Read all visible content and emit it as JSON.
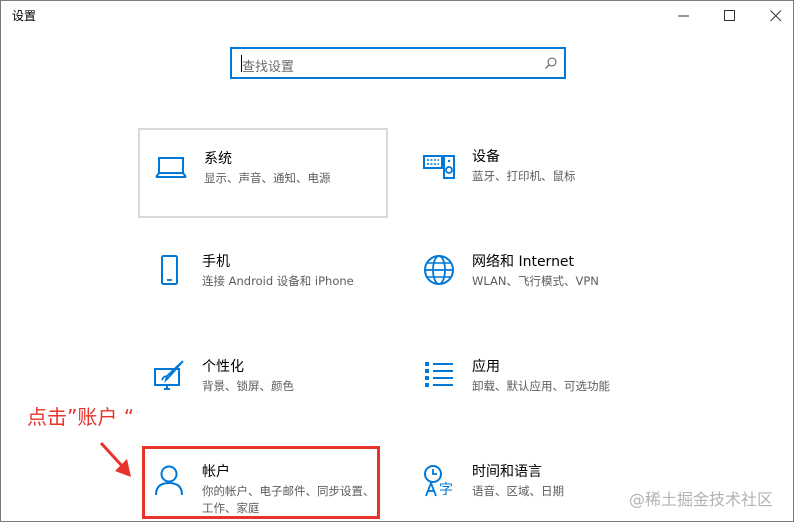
{
  "window": {
    "title": "设置"
  },
  "search": {
    "placeholder": "查找设置"
  },
  "tiles": [
    {
      "title": "系统",
      "desc": "显示、声音、通知、电源",
      "icon": "laptop-icon"
    },
    {
      "title": "设备",
      "desc": "蓝牙、打印机、鼠标",
      "icon": "keyboard-speaker-icon"
    },
    {
      "title": "手机",
      "desc": "连接 Android 设备和 iPhone",
      "icon": "phone-icon"
    },
    {
      "title": "网络和 Internet",
      "desc": "WLAN、飞行模式、VPN",
      "icon": "globe-icon"
    },
    {
      "title": "个性化",
      "desc": "背景、锁屏、颜色",
      "icon": "paint-monitor-icon"
    },
    {
      "title": "应用",
      "desc": "卸载、默认应用、可选功能",
      "icon": "apps-list-icon"
    },
    {
      "title": "帐户",
      "desc": "你的帐户、电子邮件、同步设置、工作、家庭",
      "icon": "person-icon"
    },
    {
      "title": "时间和语言",
      "desc": "语音、区域、日期",
      "icon": "time-language-icon"
    }
  ],
  "annotation": {
    "text": "点击”账户 “",
    "color": "#e8332b"
  },
  "watermark": "@稀土掘金技术社区",
  "colors": {
    "accent": "#0078d7",
    "annotation": "#e8332b"
  }
}
